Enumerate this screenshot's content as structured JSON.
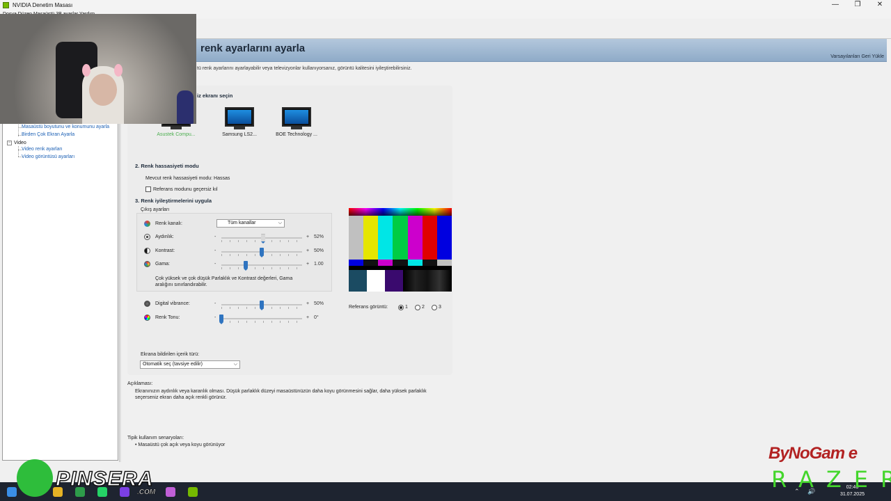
{
  "window": {
    "title": "NVIDIA Denetim Masası",
    "menu": "Dosya  Düzen  Masaüstü  3B ayarlar  Yardım"
  },
  "window_buttons": {
    "minimize": "—",
    "maximize": "❐",
    "close": "✕"
  },
  "tree": {
    "items": [
      {
        "label": "Masaüstü boyutunu ve konumunu ayarla",
        "type": "link"
      },
      {
        "label": "Birden Çok Ekran Ayarla",
        "type": "link"
      },
      {
        "label": "Video",
        "type": "category"
      },
      {
        "label": "Video renk ayarları",
        "type": "link"
      },
      {
        "label": "Video görüntüsü ayarları",
        "type": "link"
      }
    ],
    "expander": "−"
  },
  "header": {
    "title": "renk ayarlarını ayarla",
    "restore_defaults": "Varsayılanları Geri Yükle",
    "intro": "tü renk ayarlarını ayarlayabilir veya televizyonlar kullanıyorsanız, görüntü kalitesini iyileştirebilirsiniz."
  },
  "step1": {
    "title": "iz ekranı seçin",
    "displays": [
      {
        "label": "Asustek Compu...",
        "selected": true
      },
      {
        "label": "Samsung LS2...",
        "selected": false
      },
      {
        "label": "BOE Technology ...",
        "selected": false
      }
    ]
  },
  "step2": {
    "title": "2. Renk hassasiyeti modu",
    "current_mode": "Mevcut renk hassasiyeti modu: Hassas",
    "override_label": "Referans modunu geçersiz kıl",
    "override_checked": false
  },
  "step3": {
    "title": "3. Renk iyileştirmelerini uygula",
    "group_label": "Çıkış ayarları",
    "channel": {
      "label": "Renk kanalı:",
      "value": "Tüm kanallar"
    },
    "sliders": [
      {
        "label": "Aydınlık:",
        "value_text": "52%",
        "fraction": 0.52,
        "icon": "sun-icon",
        "ghost": true
      },
      {
        "label": "Kontrast:",
        "value_text": "50%",
        "fraction": 0.5,
        "icon": "contrast-icon",
        "ghost": false
      },
      {
        "label": "Gama:",
        "value_text": "1.00",
        "fraction": 0.3,
        "icon": "gamma-icon",
        "ghost": false
      }
    ],
    "warning": "Çok yüksek ve çok düşük Parlaklık ve Kontrast değerleri, Gama aralığını sınırlandırabilir.",
    "extra_sliders": [
      {
        "label": "Digital vibrance:",
        "value_text": "50%",
        "fraction": 0.5,
        "icon": "vibrance-icon"
      },
      {
        "label": "Renk Tonu:",
        "value_text": "0°",
        "fraction": 0.0,
        "icon": "hue-icon"
      }
    ],
    "minus": "-",
    "plus": "+",
    "content_type": {
      "label": "Ekrana bildirilen içerik türü:",
      "value": "Otomatik seç (tavsiye edilir)"
    }
  },
  "reference": {
    "label": "Referans görüntü:",
    "options": [
      "1",
      "2",
      "3"
    ],
    "selected": "1"
  },
  "description": {
    "title": "Açıklaması:",
    "text": "Ekranınızın aydınlık veya karanlık olması. Düşük parlaklık düzeyi masaüstünüzün daha koyu görünmesini sağlar, daha yüksek parlaklık seçerseniz ekran daha açık renkli görünür."
  },
  "scenarios": {
    "title": "Tipik kullanım senaryoları:",
    "items": [
      "Masaüstü çok açık veya koyu görünüyor"
    ]
  },
  "colors": {
    "bars": [
      "#c0c0c0",
      "#e6e600",
      "#00e6e6",
      "#00cc44",
      "#cc00cc",
      "#e00000",
      "#0000e0"
    ],
    "bars_small": [
      "#0000e0",
      "#111111",
      "#cc00cc",
      "#111111",
      "#00e6e6",
      "#111111",
      "#c0c0c0"
    ],
    "accent": "#2f74c0",
    "banner": "#9fb7cf",
    "selected_display": "#4caf50"
  },
  "taskbar": {
    "time": "02:46",
    "date": "31.07.2025"
  },
  "watermarks": {
    "pinsera": "PINSERA",
    "com": ".COM",
    "bynogame": "ByNoGam e",
    "razer": "RAZER"
  }
}
